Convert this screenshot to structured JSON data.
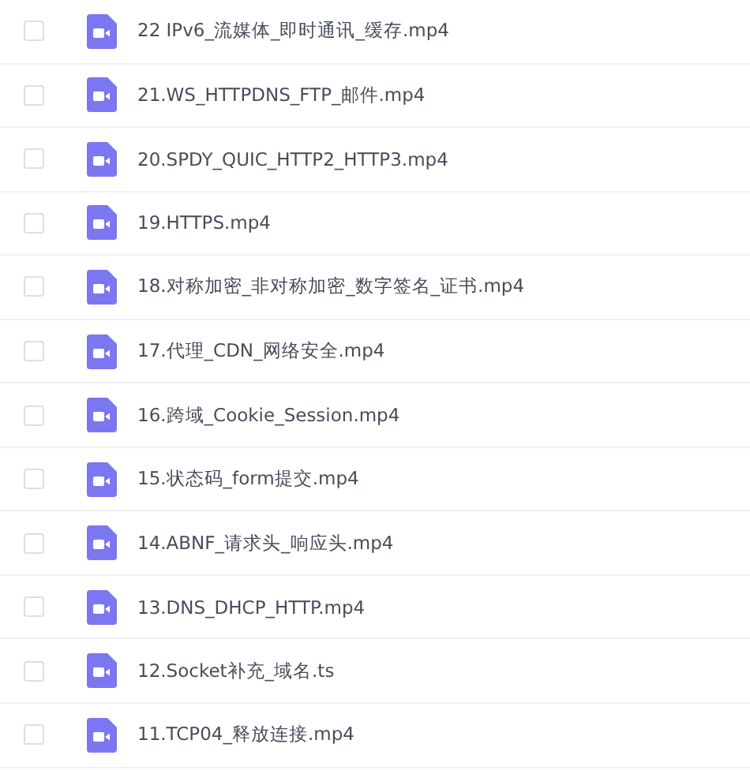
{
  "files": [
    {
      "name": "22 IPv6_流媒体_即时通讯_缓存.mp4",
      "checked": false
    },
    {
      "name": "21.WS_HTTPDNS_FTP_邮件.mp4",
      "checked": false
    },
    {
      "name": "20.SPDY_QUIC_HTTP2_HTTP3.mp4",
      "checked": false
    },
    {
      "name": "19.HTTPS.mp4",
      "checked": false
    },
    {
      "name": "18.对称加密_非对称加密_数字签名_证书.mp4",
      "checked": false
    },
    {
      "name": "17.代理_CDN_网络安全.mp4",
      "checked": false
    },
    {
      "name": "16.跨域_Cookie_Session.mp4",
      "checked": false
    },
    {
      "name": "15.状态码_form提交.mp4",
      "checked": false
    },
    {
      "name": "14.ABNF_请求头_响应头.mp4",
      "checked": false
    },
    {
      "name": "13.DNS_DHCP_HTTP.mp4",
      "checked": false
    },
    {
      "name": "12.Socket补充_域名.ts",
      "checked": false
    },
    {
      "name": "11.TCP04_释放连接.mp4",
      "checked": false
    }
  ]
}
